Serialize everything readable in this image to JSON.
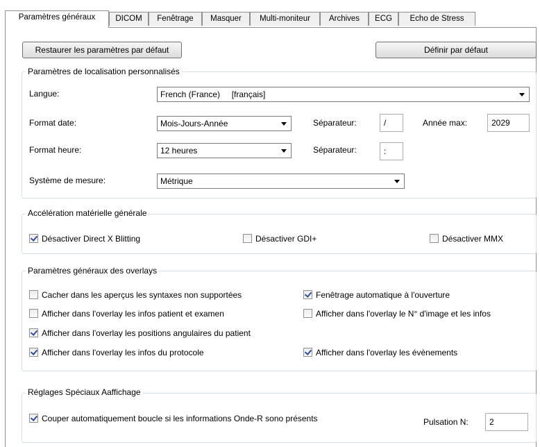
{
  "tabs": [
    {
      "label": "Paramètres généraux"
    },
    {
      "label": "DICOM"
    },
    {
      "label": "Fenêtrage"
    },
    {
      "label": "Masquer"
    },
    {
      "label": "Multi-moniteur"
    },
    {
      "label": "Archives"
    },
    {
      "label": "ECG"
    },
    {
      "label": "Echo de Stress"
    }
  ],
  "actions": {
    "restore_label": "Restaurer les paramètres par défaut",
    "set_default_label": "Définir par défaut"
  },
  "localisation": {
    "title": "Paramètres de localisation personnalisés",
    "language_label": "Langue:",
    "language_value": "French (France)     [français]",
    "date_format_label": "Format date:",
    "date_format_value": "Mois-Jours-Année",
    "date_separator_label": "Séparateur:",
    "date_separator_value": "/",
    "max_year_label": "Année max:",
    "max_year_value": "2029",
    "time_format_label": "Format heure:",
    "time_format_value": "12 heures",
    "time_separator_label": "Séparateur:",
    "time_separator_value": ":",
    "measure_label": "Système de mesure:",
    "measure_value": "Métrique"
  },
  "acceleration": {
    "title": "Accélération matérielle générale",
    "options": [
      {
        "label": "Désactiver Direct X Blitting",
        "checked": true
      },
      {
        "label": "Désactiver GDI+",
        "checked": false
      },
      {
        "label": "Désactiver MMX",
        "checked": false
      }
    ]
  },
  "overlays": {
    "title": "Paramètres généraux des overlays",
    "options": [
      {
        "label": "Cacher dans les aperçus les syntaxes non supportées",
        "checked": false
      },
      {
        "label": "Fenêtrage automatique à l'ouverture",
        "checked": true
      },
      {
        "label": "Afficher dans l'overlay les infos patient et examen",
        "checked": false
      },
      {
        "label": "Afficher dans l'overlay le N° d'image et les infos",
        "checked": false
      },
      {
        "label": "Afficher dans l'overlay les positions angulaires du patient",
        "checked": true
      },
      {
        "label": "Afficher dans l'overlay les infos du protocole",
        "checked": true
      },
      {
        "label": "Afficher dans l'overlay les évènements",
        "checked": true
      }
    ]
  },
  "special": {
    "title": "Réglages Spéciaux Aaffichage",
    "option": {
      "label": "Couper automatiquement boucle si les informations Onde-R sono présents",
      "checked": true
    },
    "pulsation_label": "Pulsation N:",
    "pulsation_value": "2"
  }
}
